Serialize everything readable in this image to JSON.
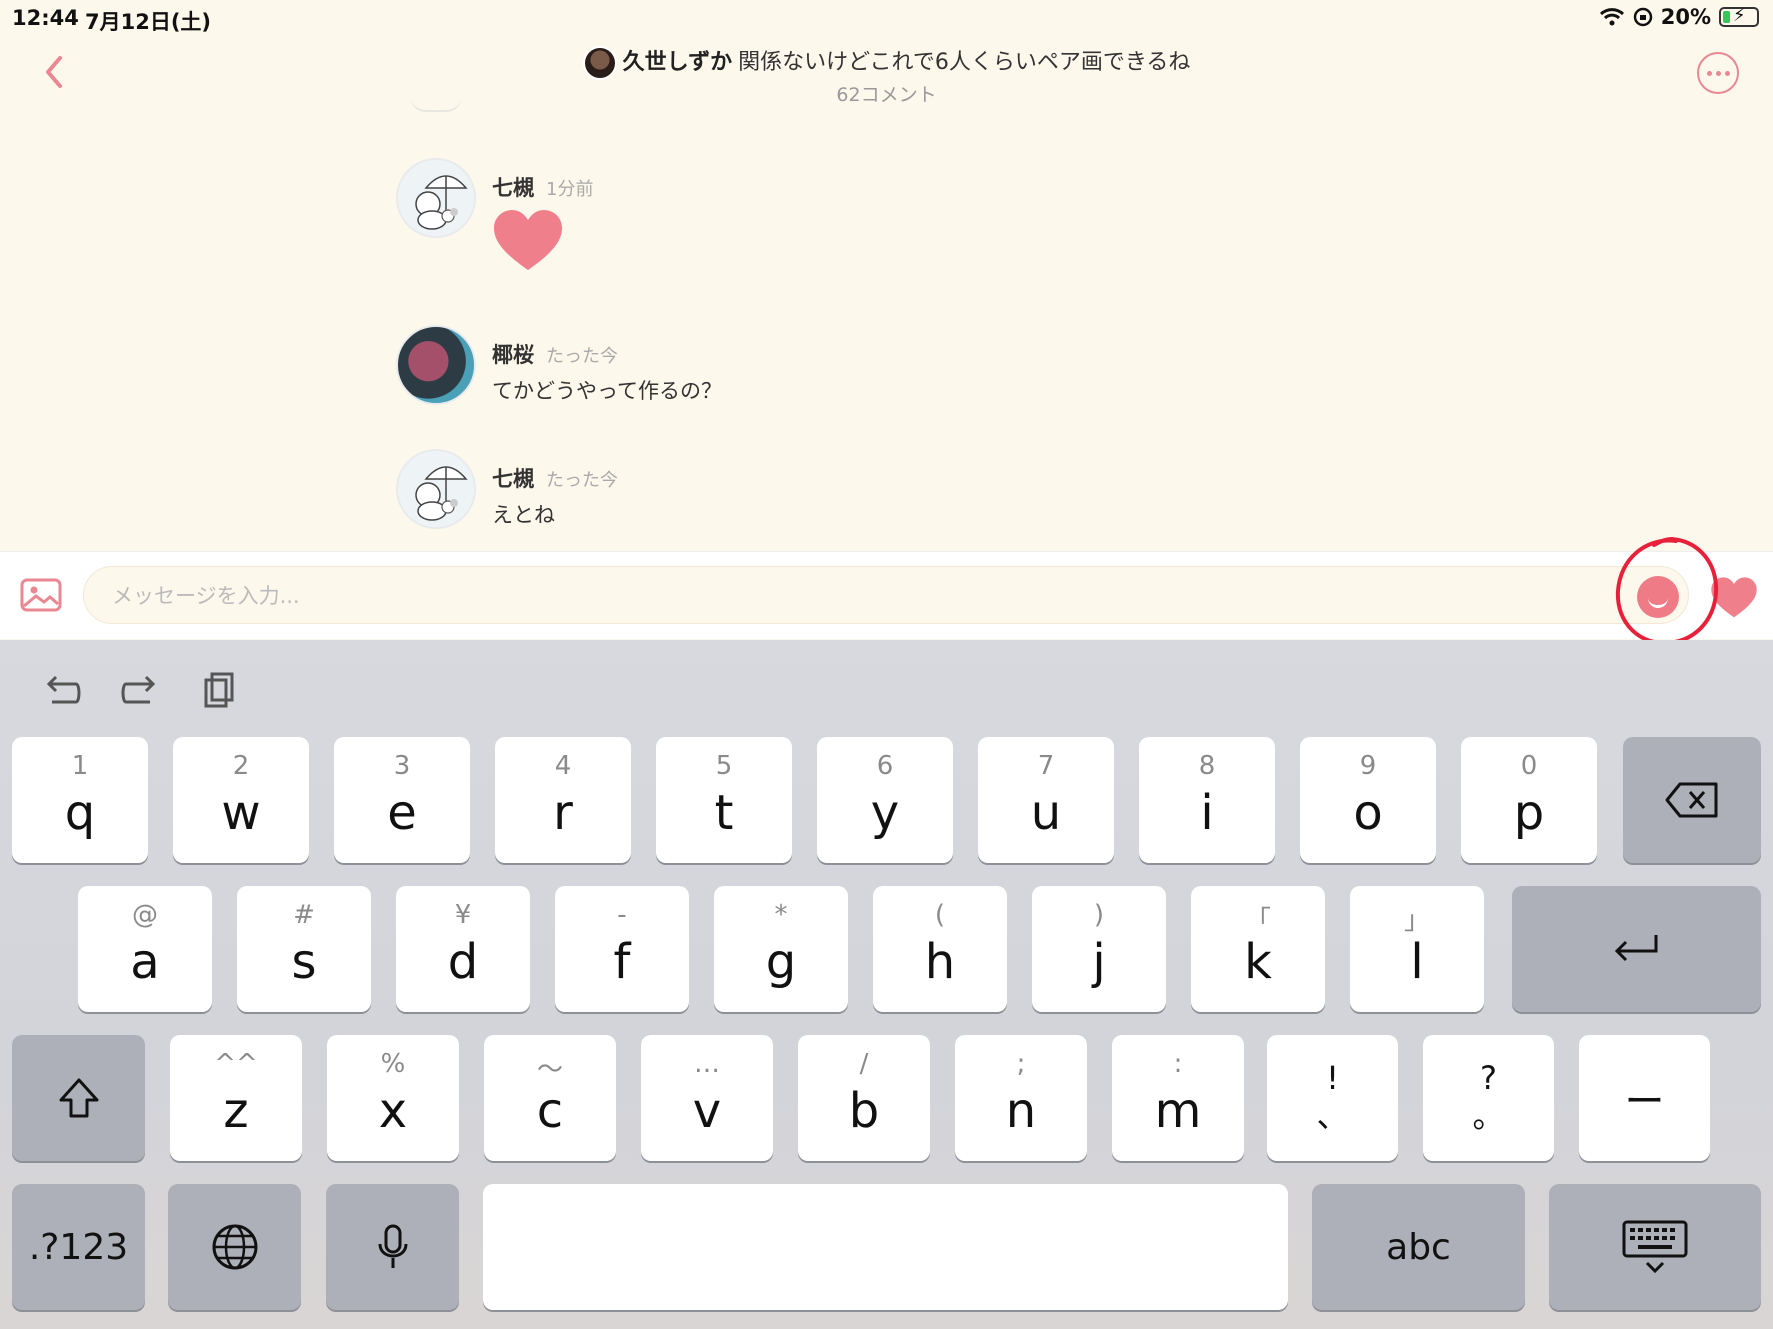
{
  "status": {
    "time": "12:44",
    "date": "7月12日(土)",
    "battery": "20%"
  },
  "header": {
    "author": "久世しずか",
    "title": "関係ないけどこれで6人くらいペア画できるね",
    "comment_count": "62コメント",
    "icons": {
      "back": "chevron-left-icon",
      "more": "ellipsis-icon"
    }
  },
  "messages": [
    {
      "user": "七槻",
      "time": "1分前",
      "type": "heart-sticker",
      "text": ""
    },
    {
      "user": "椰桜",
      "time": "たった今",
      "type": "text",
      "text": "てかどうやって作るの？"
    },
    {
      "user": "七槻",
      "time": "たった今",
      "type": "text",
      "text": "えとね"
    }
  ],
  "input": {
    "placeholder": "メッセージを入力..."
  },
  "keyboard": {
    "row1": [
      {
        "sub": "1",
        "main": "q"
      },
      {
        "sub": "2",
        "main": "w"
      },
      {
        "sub": "3",
        "main": "e"
      },
      {
        "sub": "4",
        "main": "r"
      },
      {
        "sub": "5",
        "main": "t"
      },
      {
        "sub": "6",
        "main": "y"
      },
      {
        "sub": "7",
        "main": "u"
      },
      {
        "sub": "8",
        "main": "i"
      },
      {
        "sub": "9",
        "main": "o"
      },
      {
        "sub": "0",
        "main": "p"
      }
    ],
    "row2": [
      {
        "sub": "@",
        "main": "a"
      },
      {
        "sub": "#",
        "main": "s"
      },
      {
        "sub": "¥",
        "main": "d"
      },
      {
        "sub": "-",
        "main": "f"
      },
      {
        "sub": "*",
        "main": "g"
      },
      {
        "sub": "(",
        "main": "h"
      },
      {
        "sub": ")",
        "main": "j"
      },
      {
        "sub": "「",
        "main": "k"
      },
      {
        "sub": "」",
        "main": "l"
      }
    ],
    "row3": [
      {
        "sub": "^^",
        "main": "z"
      },
      {
        "sub": "%",
        "main": "x"
      },
      {
        "sub": "〜",
        "main": "c"
      },
      {
        "sub": "…",
        "main": "v"
      },
      {
        "sub": "/",
        "main": "b"
      },
      {
        "sub": ";",
        "main": "n"
      },
      {
        "sub": ":",
        "main": "m"
      }
    ],
    "punct": [
      {
        "top": "!",
        "bottom": "、"
      },
      {
        "top": "?",
        "bottom": "。"
      },
      {
        "top": "ー",
        "bottom": ""
      }
    ],
    "numbers_label": ".?123",
    "abc_label": "abc",
    "space_label": ""
  },
  "colors": {
    "accent": "#e98792",
    "background": "#fdf8ec",
    "annotation": "#e8213a"
  }
}
